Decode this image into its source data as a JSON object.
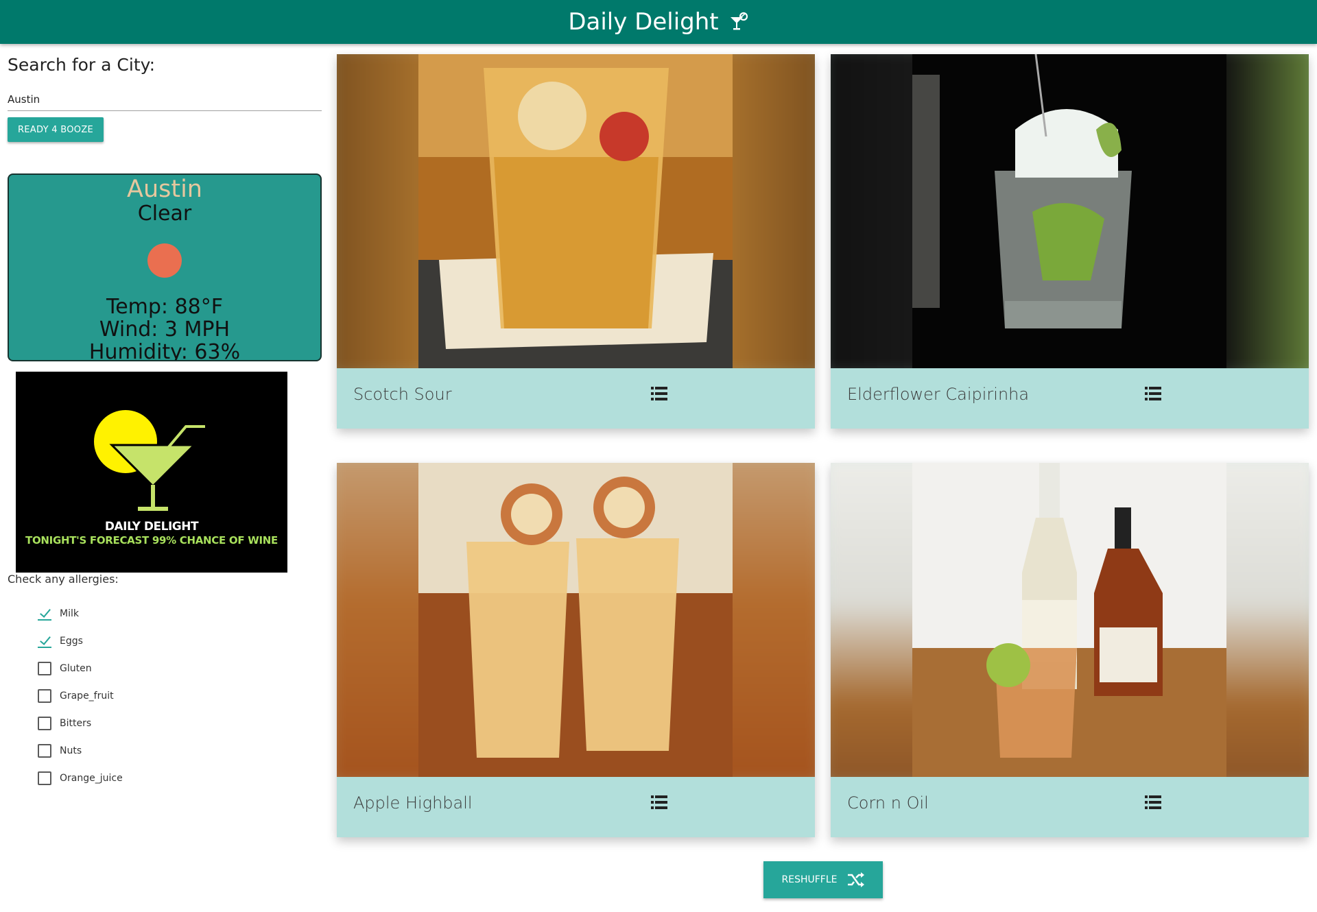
{
  "header": {
    "title": "Daily Delight",
    "icon": "cocktail-glass-icon"
  },
  "search": {
    "label": "Search for a City:",
    "value": "Austin",
    "button_label": "READY 4 BOOZE"
  },
  "weather": {
    "city": "Austin",
    "condition": "Clear",
    "icon": "sun-icon",
    "temp": "Temp: 88°F",
    "wind": "Wind: 3 MPH",
    "humidity": "Humidity: 63%"
  },
  "logo": {
    "title": "DAILY DELIGHT",
    "subtitle": "TONIGHT'S FORECAST 99% CHANCE OF WINE"
  },
  "allergies": {
    "label": "Check any allergies:",
    "items": [
      {
        "name": "Milk",
        "checked": true
      },
      {
        "name": "Eggs",
        "checked": true
      },
      {
        "name": "Gluten",
        "checked": false
      },
      {
        "name": "Grape_fruit",
        "checked": false
      },
      {
        "name": "Bitters",
        "checked": false
      },
      {
        "name": "Nuts",
        "checked": false
      },
      {
        "name": "Orange_juice",
        "checked": false
      }
    ]
  },
  "drinks": [
    {
      "name": "Scotch Sour",
      "icon": "list-icon"
    },
    {
      "name": "Elderflower Caipirinha",
      "icon": "list-icon"
    },
    {
      "name": "Apple Highball",
      "icon": "list-icon"
    },
    {
      "name": "Corn n Oil",
      "icon": "list-icon"
    }
  ],
  "reshuffle": {
    "label": "RESHUFFLE",
    "icon": "shuffle-icon"
  },
  "colors": {
    "nav": "#00796b",
    "accent": "#26a69a",
    "card": "#b2dfdb",
    "weather_bg": "#26998e",
    "sun": "#ea6f50"
  }
}
